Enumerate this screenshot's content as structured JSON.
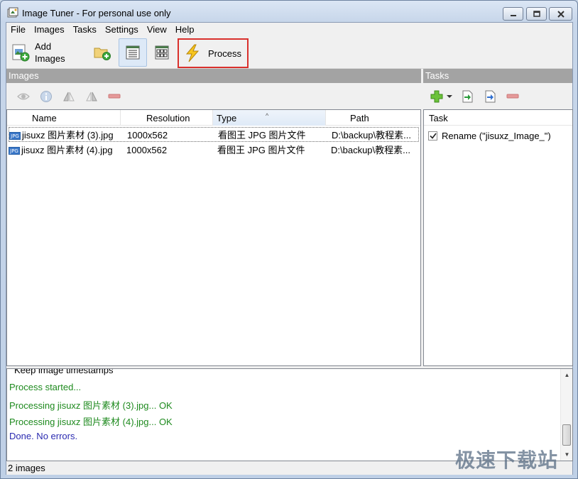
{
  "window": {
    "title": "Image Tuner - For personal use only"
  },
  "menu": [
    "File",
    "Images",
    "Tasks",
    "Settings",
    "View",
    "Help"
  ],
  "toolbar": {
    "add_images_line1": "Add",
    "add_images_line2": "Images",
    "process_label": "Process"
  },
  "images_panel": {
    "title": "Images",
    "columns": [
      "Name",
      "Resolution",
      "Type",
      "Path"
    ],
    "sorted_column": "Type",
    "rows": [
      {
        "name": "jisuxz 图片素材 (3).jpg",
        "resolution": "1000x562",
        "type": "看图王 JPG 图片文件",
        "path": "D:\\backup\\教程素...",
        "selected": true
      },
      {
        "name": "jisuxz 图片素材 (4).jpg",
        "resolution": "1000x562",
        "type": "看图王 JPG 图片文件",
        "path": "D:\\backup\\教程素...",
        "selected": false
      }
    ],
    "file_badge": "JPG"
  },
  "tasks_panel": {
    "title": "Tasks",
    "column": "Task",
    "tasks": [
      {
        "label": "Rename (\"jisuxz_Image_\")",
        "checked": true
      }
    ]
  },
  "log": {
    "partial_top": "Keep image timestamps",
    "lines": [
      {
        "text": "Process started...",
        "color": "#1e8a1e"
      },
      {
        "text": "Processing jisuxz 图片素材 (3).jpg... OK",
        "color": "#1e8a1e"
      },
      {
        "text": "Processing jisuxz 图片素材 (4).jpg... OK",
        "color": "#1e8a1e"
      },
      {
        "text": "Done. No errors.",
        "color": "#2a2ab0"
      }
    ]
  },
  "status": {
    "text": "2 images"
  },
  "watermark": "极速下载站"
}
